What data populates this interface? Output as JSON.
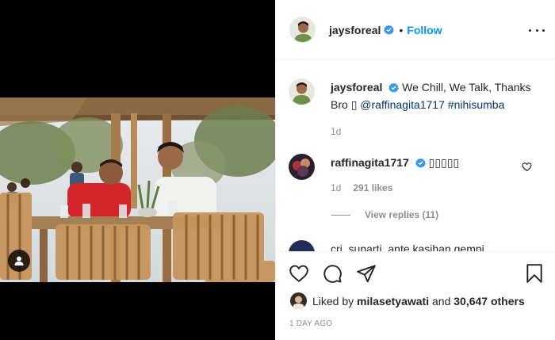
{
  "post": {
    "username": "jaysforeal",
    "follow_label": "Follow",
    "separator": "•"
  },
  "caption": {
    "username": "jaysforeal",
    "text_part1": "We Chill, We Talk, Thanks Bro",
    "emoji": "▯",
    "mention": "@raffinagita1717",
    "hashtag": "#nihisumba",
    "time": "1d"
  },
  "comment1": {
    "username": "raffinagita1717",
    "text": "▯▯▯▯▯",
    "time": "1d",
    "likes": "291 likes",
    "view_replies": "View replies (11)"
  },
  "comment2": {
    "partial_text": "cri_suparti_ante  kasihan gempi"
  },
  "likes": {
    "prefix": "Liked by",
    "user": "milasetyawati",
    "connector": "and",
    "others": "30,647 others"
  },
  "timestamp": "1 DAY AGO",
  "colors": {
    "accent": "#0095f6",
    "verified": "#3897f0",
    "muted": "#8e8e8e",
    "border": "#efefef"
  },
  "icons": [
    "verified-badge-icon",
    "more-options-icon",
    "heart-icon",
    "comment-icon",
    "share-icon",
    "save-icon",
    "user-tag-icon"
  ]
}
